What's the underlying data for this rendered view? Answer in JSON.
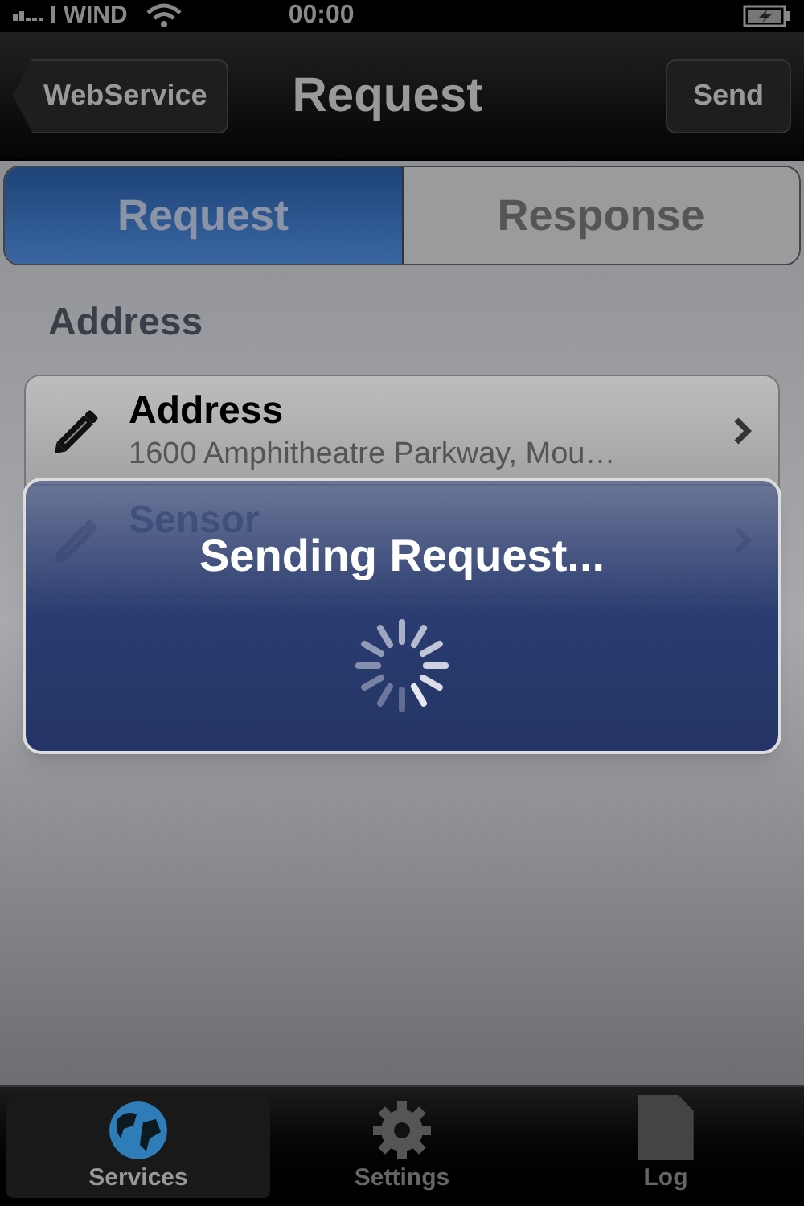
{
  "status_bar": {
    "carrier": "I WIND",
    "time": "00:00"
  },
  "nav_bar": {
    "back": "WebService",
    "title": "Request",
    "action": "Send"
  },
  "segments": [
    {
      "label": "Request",
      "selected": true
    },
    {
      "label": "Response",
      "selected": false
    }
  ],
  "section_header": "Address",
  "rows": [
    {
      "title": "Address",
      "value": "1600 Amphitheatre Parkway, Mou…"
    },
    {
      "title": "Sensor"
    }
  ],
  "hud": {
    "message": "Sending Request..."
  },
  "tab_bar": [
    {
      "kind": "globe",
      "label": "Services",
      "selected": true
    },
    {
      "kind": "gear",
      "label": "Settings",
      "selected": false
    },
    {
      "kind": "page",
      "label": "Log",
      "selected": false
    }
  ]
}
